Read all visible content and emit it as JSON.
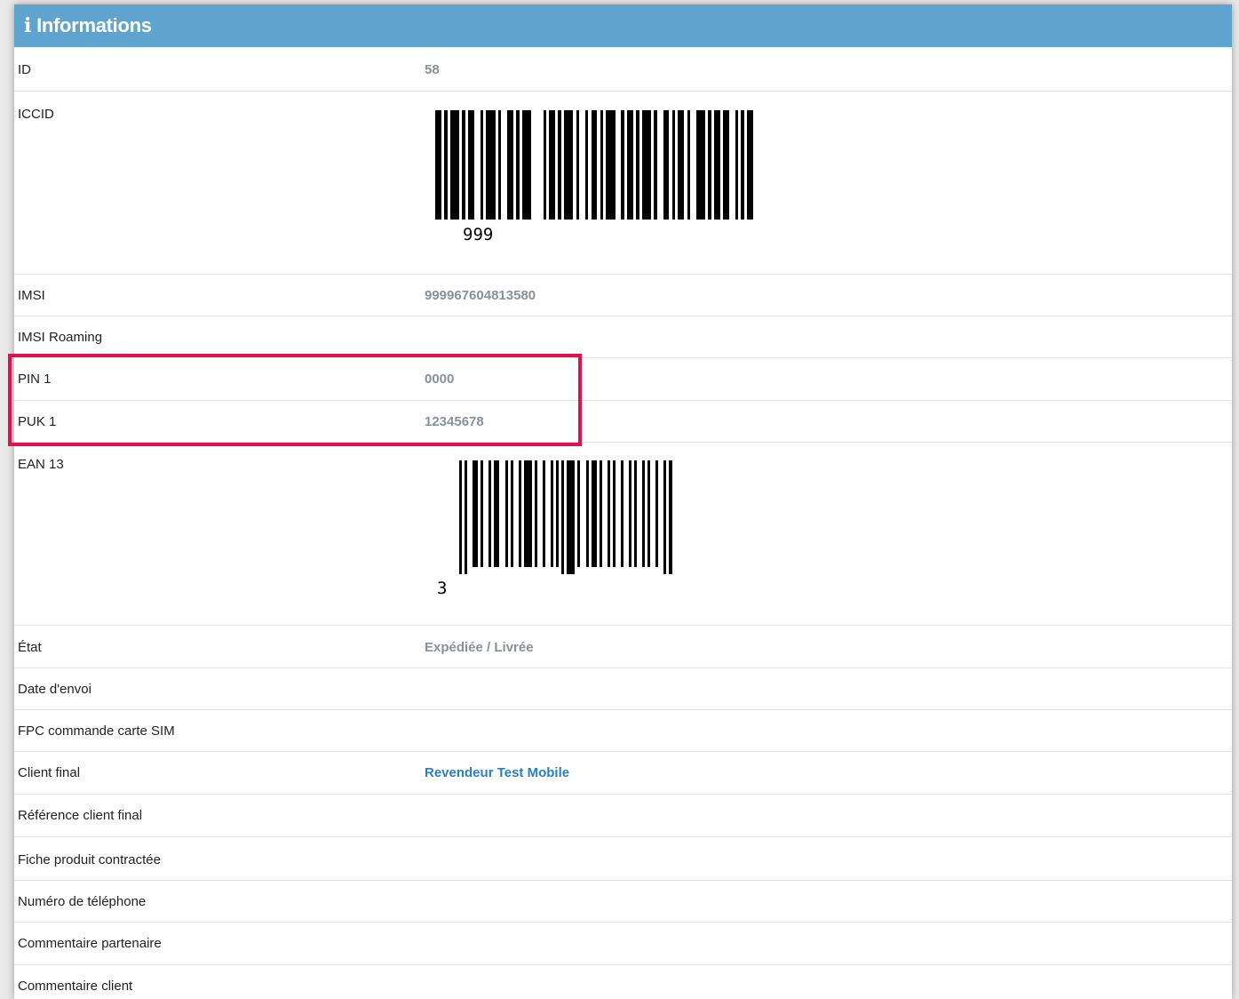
{
  "panel": {
    "title": "Informations",
    "icon": "info-icon"
  },
  "rows": [
    {
      "label": "ID",
      "value": "58"
    },
    {
      "label": "ICCID",
      "value": "999"
    },
    {
      "label": "IMSI",
      "value": "999967604813580"
    },
    {
      "label": "IMSI Roaming",
      "value": ""
    },
    {
      "label": "PIN 1",
      "value": "0000"
    },
    {
      "label": "PUK 1",
      "value": "12345678"
    },
    {
      "label": "EAN 13",
      "value": "3"
    },
    {
      "label": "État",
      "value": "Expédiée / Livrée"
    },
    {
      "label": "Date d'envoi",
      "value": ""
    },
    {
      "label": "FPC commande carte SIM",
      "value": ""
    },
    {
      "label": "Client final",
      "value": "Revendeur Test Mobile"
    },
    {
      "label": "Référence client final",
      "value": ""
    },
    {
      "label": "Fiche produit contractée",
      "value": ""
    },
    {
      "label": "Numéro de téléphone",
      "value": ""
    },
    {
      "label": "Commentaire partenaire",
      "value": ""
    },
    {
      "label": "Commentaire client",
      "value": ""
    }
  ],
  "colors": {
    "header_bg": "#5fa3cf",
    "highlight": "#e0114f",
    "link": "#2a7fc0",
    "value": "#8a8f99"
  }
}
